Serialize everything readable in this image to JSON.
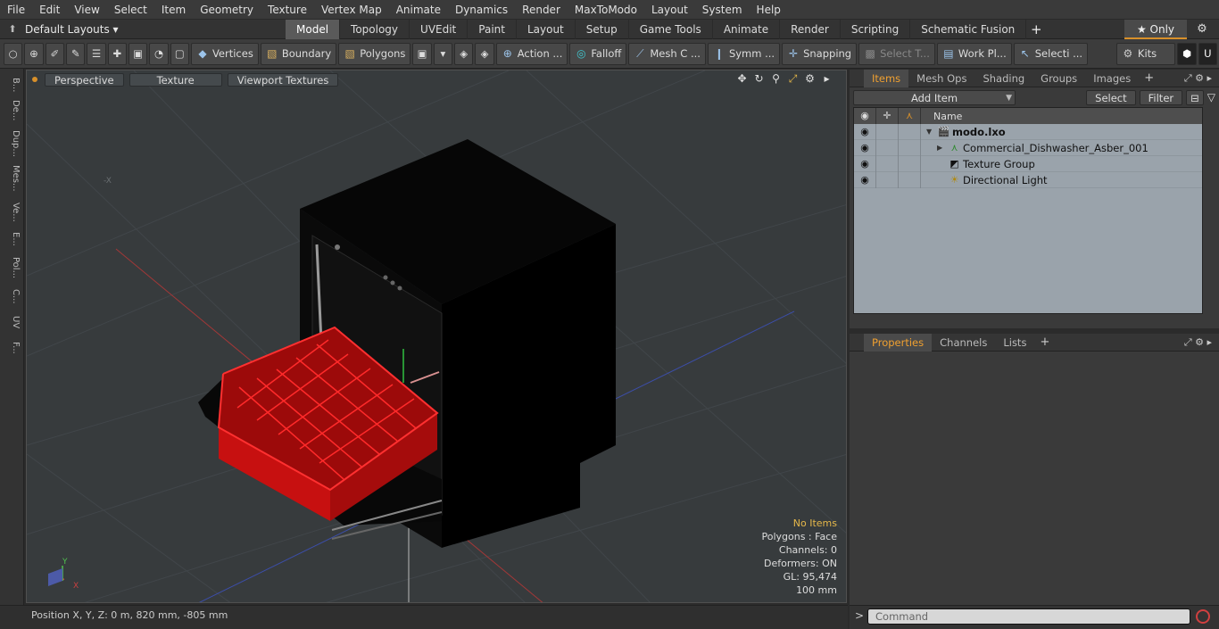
{
  "menu": [
    "File",
    "Edit",
    "View",
    "Select",
    "Item",
    "Geometry",
    "Texture",
    "Vertex Map",
    "Animate",
    "Dynamics",
    "Render",
    "MaxToModo",
    "Layout",
    "System",
    "Help"
  ],
  "layoutbar": {
    "layout_name": "Default Layouts ▾",
    "tabs": [
      "Model",
      "Topology",
      "UVEdit",
      "Paint",
      "Layout",
      "Setup",
      "Game Tools",
      "Animate",
      "Render",
      "Scripting",
      "Schematic Fusion"
    ],
    "active_tab": "Model",
    "plus": "+",
    "only_label": "★ Only",
    "accent_color": "#d8902a"
  },
  "toolbar": {
    "vertices": "Vertices",
    "boundary": "Boundary",
    "polygons": "Polygons",
    "action": "Action",
    "action_more": "...",
    "falloff": "Falloff",
    "meshc": "Mesh C ...",
    "symm": "Symm ...",
    "snapping": "Snapping",
    "select_t": "Select T...",
    "work_pl": "Work Pl...",
    "selecti": "Selecti ...",
    "kits": "Kits"
  },
  "left_tabs": [
    "B...",
    "De...",
    "Dup...",
    "Mes...",
    "Ve...",
    "E...",
    "Pol...",
    "C...",
    "UV",
    "F..."
  ],
  "viewport": {
    "view_mode": "Perspective",
    "shading": "Texture",
    "viewport_textures": "Viewport Textures",
    "info": {
      "items": "No Items",
      "polygons": "Polygons : Face",
      "channels": "Channels: 0",
      "deformers": "Deformers: ON",
      "gl": "GL: 95,474",
      "scale": "100 mm"
    },
    "axis_x": "X",
    "axis_y": "Y",
    "axis_neg_x": "-X"
  },
  "status": {
    "position": "Position X, Y, Z:   0 m, 820 mm, -805 mm"
  },
  "items_panel": {
    "tabs": [
      "Items",
      "Mesh Ops",
      "Shading",
      "Groups",
      "Images"
    ],
    "active_tab": "Items",
    "plus": "+",
    "add_item": "Add Item",
    "select": "Select",
    "filter": "Filter",
    "name_header": "Name",
    "rows": [
      {
        "label": "modo.lxo",
        "bold": true,
        "expander": "▼",
        "icon": "scene-icon"
      },
      {
        "label": "Commercial_Dishwasher_Asber_001",
        "bold": false,
        "expander": "▶",
        "icon": "mesh-icon"
      },
      {
        "label": "Texture Group",
        "bold": false,
        "expander": "",
        "icon": "texture-group-icon"
      },
      {
        "label": "Directional Light",
        "bold": false,
        "expander": "",
        "icon": "light-icon"
      }
    ]
  },
  "properties_panel": {
    "tabs": [
      "Properties",
      "Channels",
      "Lists"
    ],
    "active_tab": "Properties",
    "plus": "+"
  },
  "command": {
    "prompt": ">",
    "placeholder": "Command"
  }
}
